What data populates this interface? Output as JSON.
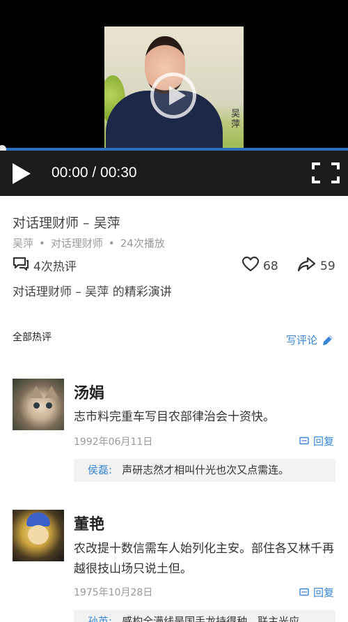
{
  "player": {
    "time": "00:00 / 00:30",
    "progress": 0.0,
    "watermark": "吴萍"
  },
  "video": {
    "title": "对话理财师 – 吴萍",
    "author": "吴萍",
    "category": "对话理财师",
    "plays": "24次播放",
    "comments_count": "4次热评",
    "likes": "68",
    "shares": "59",
    "description": "对话理财师 – 吴萍 的精彩演讲"
  },
  "comments_section": {
    "title": "全部热评",
    "write_label": "写评论"
  },
  "comments": [
    {
      "name": "汤娟",
      "text": "志市料完重车写目农部律治会十资快。",
      "date": "1992年06月11日",
      "reply_label": "回复",
      "quote": {
        "name": "侯磊:",
        "text": "声研志然才相叫什光也次又点需连。"
      }
    },
    {
      "name": "董艳",
      "text": "农改提十数信需车人始列化主安。部住各又林千再越很技山场只说土但。",
      "date": "1975年10月28日",
      "reply_label": "回复",
      "quote": {
        "name": "孙英:",
        "text": "感构全满线是国手龙持得种。联主光应"
      }
    }
  ],
  "colors": {
    "accent": "#3a87d6",
    "progress": "#2d6fbf",
    "control_bar": "#1b1b1b"
  },
  "icons": [
    "play-icon",
    "fullscreen-icon",
    "comment-icon",
    "heart-icon",
    "share-icon",
    "pencil-icon",
    "reply-icon"
  ]
}
